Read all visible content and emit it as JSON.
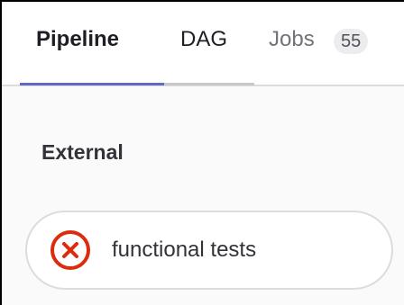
{
  "tabs": [
    {
      "label": "Pipeline",
      "active": true
    },
    {
      "label": "DAG",
      "active": false
    },
    {
      "label": "Jobs",
      "active": false,
      "badge": "55"
    }
  ],
  "section": {
    "title": "External"
  },
  "job": {
    "name": "functional tests",
    "status": "failed",
    "status_icon": "status-failed-icon",
    "status_color": "#dd2b0e"
  },
  "colors": {
    "active_tab_underline": "#6666c4",
    "text_primary": "#333238",
    "failed": "#dd2b0e"
  }
}
